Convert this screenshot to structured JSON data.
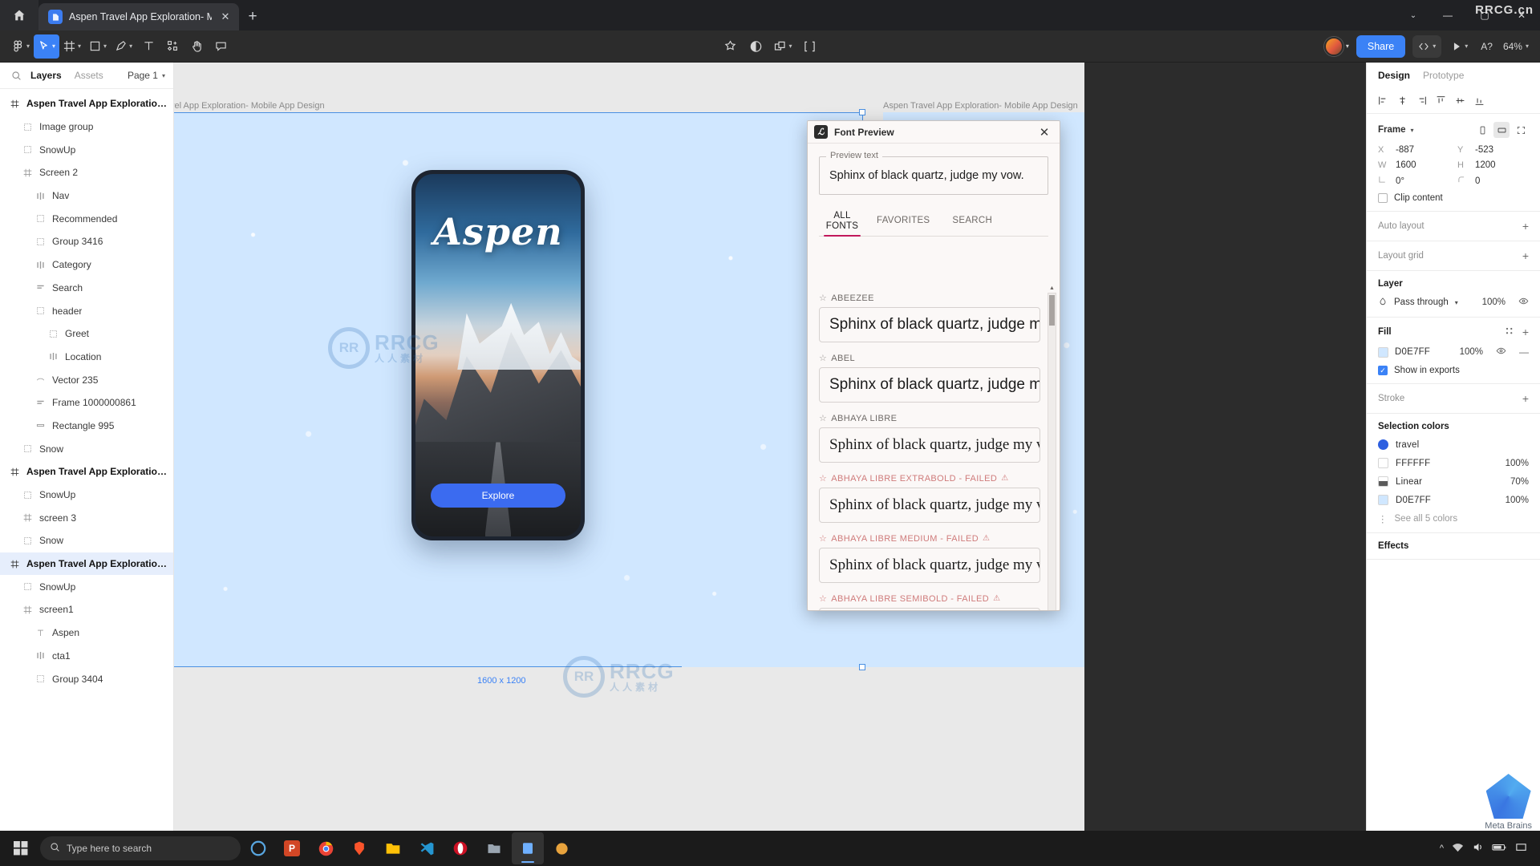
{
  "browser": {
    "home_icon": "home-icon",
    "tab_title": "Aspen Travel App Exploration- Mob",
    "tab_close": "✕",
    "new_tab": "+",
    "window_minimize": "—",
    "window_maximize": "▢",
    "window_close": "✕",
    "watermark": "RRCG.cn"
  },
  "toolbar": {
    "menu_icon": "figma-logo-icon",
    "move_tool": "move-cursor-icon",
    "frame_tool": "frame-icon",
    "shape_tool": "rectangle-icon",
    "pen_tool": "pen-icon",
    "text_tool": "text-icon",
    "component_tool": "components-icon",
    "hand_tool": "hand-icon",
    "comment_tool": "comment-icon",
    "actions_icon": "actions-icon",
    "contrast_icon": "contrast-icon",
    "layers_icon": "overlap-icon",
    "dev_icon": "dev-mode-icon",
    "share_label": "Share",
    "code_icon": "code-icon",
    "present_icon": "play-icon",
    "ai_label": "A?",
    "zoom_level": "64%"
  },
  "left_panel": {
    "search_icon": "search-icon",
    "tabs": [
      {
        "label": "Layers",
        "active": true
      },
      {
        "label": "Assets",
        "active": false
      }
    ],
    "page_selector": "Page 1",
    "layers": [
      {
        "name": "Aspen Travel App Exploration- M...",
        "icon": "frame-icon",
        "depth": 0,
        "root": true,
        "selected": false
      },
      {
        "name": "Image group",
        "icon": "group-icon",
        "depth": 1,
        "root": false,
        "selected": false
      },
      {
        "name": "SnowUp",
        "icon": "group-icon",
        "depth": 1,
        "root": false,
        "selected": false
      },
      {
        "name": "Screen 2",
        "icon": "frame-icon",
        "depth": 1,
        "root": false,
        "selected": false
      },
      {
        "name": "Nav",
        "icon": "autolayout-icon",
        "depth": 2,
        "root": false,
        "selected": false
      },
      {
        "name": "Recommended",
        "icon": "group-icon",
        "depth": 2,
        "root": false,
        "selected": false
      },
      {
        "name": "Group 3416",
        "icon": "group-icon",
        "depth": 2,
        "root": false,
        "selected": false
      },
      {
        "name": "Category",
        "icon": "autolayout-icon",
        "depth": 2,
        "root": false,
        "selected": false
      },
      {
        "name": "Search",
        "icon": "autolayout-vertical-icon",
        "depth": 2,
        "root": false,
        "selected": false
      },
      {
        "name": "header",
        "icon": "group-icon",
        "depth": 2,
        "root": false,
        "selected": false
      },
      {
        "name": "Greet",
        "icon": "group-icon",
        "depth": 3,
        "root": false,
        "selected": false
      },
      {
        "name": "Location",
        "icon": "autolayout-icon",
        "depth": 3,
        "root": false,
        "selected": false
      },
      {
        "name": "Vector 235",
        "icon": "vector-icon",
        "depth": 2,
        "root": false,
        "selected": false
      },
      {
        "name": "Frame 1000000861",
        "icon": "autolayout-vertical-icon",
        "depth": 2,
        "root": false,
        "selected": false
      },
      {
        "name": "Rectangle 995",
        "icon": "rectangle-icon",
        "depth": 2,
        "root": false,
        "selected": false
      },
      {
        "name": "Snow",
        "icon": "group-icon",
        "depth": 1,
        "root": false,
        "selected": false
      },
      {
        "name": "Aspen Travel App Exploration- M...",
        "icon": "frame-icon",
        "depth": 0,
        "root": true,
        "selected": false
      },
      {
        "name": "SnowUp",
        "icon": "group-icon",
        "depth": 1,
        "root": false,
        "selected": false
      },
      {
        "name": "screen 3",
        "icon": "frame-icon",
        "depth": 1,
        "root": false,
        "selected": false
      },
      {
        "name": "Snow",
        "icon": "group-icon",
        "depth": 1,
        "root": false,
        "selected": false
      },
      {
        "name": "Aspen Travel App Exploration...",
        "icon": "frame-icon",
        "depth": 0,
        "root": true,
        "selected": true
      },
      {
        "name": "SnowUp",
        "icon": "group-icon",
        "depth": 1,
        "root": false,
        "selected": false
      },
      {
        "name": "screen1",
        "icon": "frame-icon",
        "depth": 1,
        "root": false,
        "selected": false
      },
      {
        "name": "Aspen",
        "icon": "text-icon",
        "depth": 2,
        "root": false,
        "selected": false
      },
      {
        "name": "cta1",
        "icon": "autolayout-icon",
        "depth": 2,
        "root": false,
        "selected": false
      },
      {
        "name": "Group 3404",
        "icon": "group-icon",
        "depth": 2,
        "root": false,
        "selected": false
      }
    ]
  },
  "canvas": {
    "frame_label_left": "vel App Exploration- Mobile App Design",
    "frame_label_right": "Aspen Travel App Exploration- Mobile App Design",
    "artboard_size_tag": "1600 x 1200",
    "phone": {
      "title": "Aspen",
      "cta_label": "Explore"
    },
    "watermark": {
      "line1": "RRCG",
      "line2": "人人素材",
      "mark": "RR"
    }
  },
  "dialog": {
    "icon": "font-preview-icon",
    "title": "Font Preview",
    "close": "✕",
    "preview_legend": "Preview text",
    "preview_value": "Sphinx of black quartz, judge my vow.",
    "tabs": [
      {
        "label": "ALL FONTS",
        "active": true
      },
      {
        "label": "FAVORITES",
        "active": false
      },
      {
        "label": "SEARCH",
        "active": false
      }
    ],
    "sample_text": "Sphinx of black quartz, judge my vow.",
    "fonts": [
      {
        "name": "ABEEZEE",
        "failed": false,
        "style": "sans"
      },
      {
        "name": "ABEL",
        "failed": false,
        "style": "sans"
      },
      {
        "name": "ABHAYA LIBRE",
        "failed": false,
        "style": "serif"
      },
      {
        "name": "ABHAYA LIBRE EXTRABOLD - FAILED",
        "failed": true,
        "style": "serif"
      },
      {
        "name": "ABHAYA LIBRE MEDIUM - FAILED",
        "failed": true,
        "style": "serif"
      },
      {
        "name": "ABHAYA LIBRE SEMIBOLD - FAILED",
        "failed": true,
        "style": "serif"
      }
    ],
    "scroll_up": "▲",
    "scroll_down": "▼"
  },
  "right_panel": {
    "tabs": [
      {
        "label": "Design",
        "active": true
      },
      {
        "label": "Prototype",
        "active": false
      }
    ],
    "frame": {
      "title": "Frame",
      "x_key": "X",
      "x_value": "-887",
      "y_key": "Y",
      "y_value": "-523",
      "w_key": "W",
      "w_value": "1600",
      "h_key": "H",
      "h_value": "1200",
      "rotation_value": "0°",
      "corner_value": "0",
      "clip_content_label": "Clip content",
      "clip_content_checked": false
    },
    "auto_layout": {
      "title": "Auto layout",
      "add": "+"
    },
    "layout_grid": {
      "title": "Layout grid",
      "add": "+"
    },
    "layer": {
      "title": "Layer",
      "blend_mode": "Pass through",
      "opacity": "100%",
      "visibility_icon": "eye-icon"
    },
    "fill": {
      "title": "Fill",
      "color_hex": "D0E7FF",
      "color_value": "#D0E7FF",
      "opacity": "100%",
      "show_in_exports": "Show in exports",
      "show_in_exports_checked": true,
      "add": "+",
      "style_icon": "style-icon",
      "eye_icon": "eye-icon",
      "minus_icon": "minus-icon"
    },
    "stroke": {
      "title": "Stroke",
      "add": "+"
    },
    "selection_colors": {
      "title": "Selection colors",
      "items": [
        {
          "label": "travel",
          "swatch": "#2d5fe0",
          "opacity": "",
          "type": "solid"
        },
        {
          "label": "FFFFFF",
          "swatch": "#ffffff",
          "opacity": "100%",
          "type": "solid"
        },
        {
          "label": "Linear",
          "swatch": "linear",
          "opacity": "70%",
          "type": "gradient"
        },
        {
          "label": "D0E7FF",
          "swatch": "#d0e7ff",
          "opacity": "100%",
          "type": "solid"
        }
      ],
      "see_all": "See all 5 colors"
    },
    "effects": {
      "title": "Effects"
    },
    "meta_brains": "Meta Brains"
  },
  "taskbar": {
    "start_icon": "windows-icon",
    "search_placeholder": "Type here to search",
    "search_icon": "search-icon",
    "apps": [
      {
        "name": "cortana-icon"
      },
      {
        "name": "powerpoint-icon"
      },
      {
        "name": "chrome-icon"
      },
      {
        "name": "brave-icon"
      },
      {
        "name": "file-explorer-icon"
      },
      {
        "name": "vscode-icon"
      },
      {
        "name": "opera-icon"
      },
      {
        "name": "folder-icon"
      },
      {
        "name": "figma-icon"
      },
      {
        "name": "app-icon"
      }
    ],
    "tray": {
      "chevron": "^",
      "network_icon": "network-icon",
      "volume_icon": "volume-icon",
      "battery_icon": "battery-icon",
      "notification_icon": "notification-icon"
    }
  }
}
